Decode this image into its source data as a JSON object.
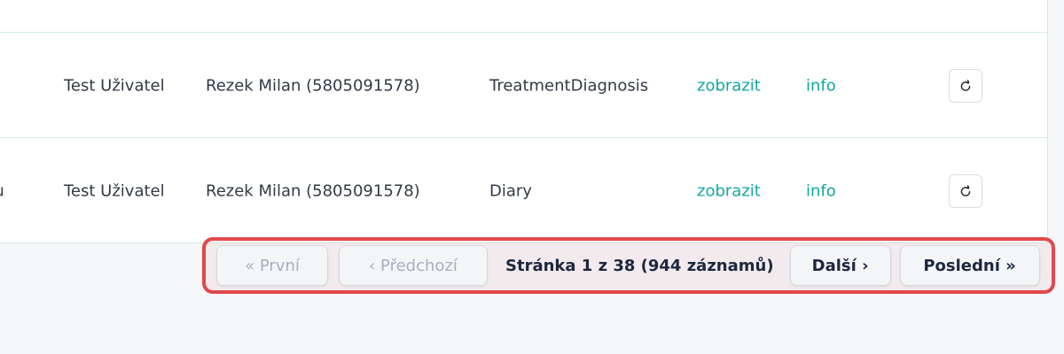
{
  "table": {
    "rows": [
      {
        "type_fragment": "",
        "user": "Test Uživatel",
        "patient": "Rezek Milan (5805091578)",
        "record_type": "TreatmentDiagnosis",
        "show_link": "zobrazit",
        "info_link": "info",
        "action_icon": "refresh-icon"
      },
      {
        "type_fragment": "nu",
        "user": "Test Uživatel",
        "patient": "Rezek Milan (5805091578)",
        "record_type": "Diary",
        "show_link": "zobrazit",
        "info_link": "info",
        "action_icon": "refresh-icon"
      }
    ]
  },
  "pagination": {
    "first_label": "« První",
    "prev_label": "‹ Předchozí",
    "status_text": "Stránka 1 z 38 (944 záznamů)",
    "next_label": "Další ›",
    "last_label": "Poslední »",
    "current_page": 1,
    "total_pages": 38,
    "total_records": 944,
    "first_enabled": false,
    "prev_enabled": false
  },
  "colors": {
    "link": "#12a8a0",
    "highlight_border": "#e0484c",
    "page_background": "#f6f7f9"
  }
}
